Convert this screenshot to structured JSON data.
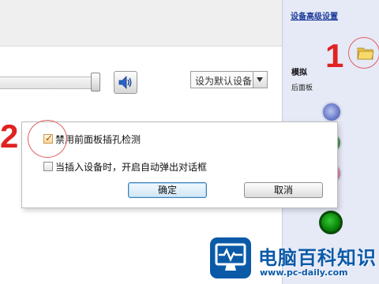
{
  "volume": {
    "level": 0.95
  },
  "default_device": {
    "label": "设为默认设备"
  },
  "right_panel": {
    "advanced_link": "设备高级设置",
    "section_title": "模拟",
    "section_subtitle": "后面板",
    "jacks": [
      "blue",
      "green",
      "pink",
      "green-active"
    ]
  },
  "annotations": {
    "one": "1",
    "two": "2",
    "color": "#e02222"
  },
  "popup": {
    "disable_front_panel": {
      "label": "禁用前面板插孔检测",
      "checked": true
    },
    "auto_popup": {
      "label": "当插入设备时，开启自动弹出对话框",
      "checked": false
    },
    "ok_label": "确定",
    "cancel_label": "取消"
  },
  "watermark": {
    "title": "电脑百科知识",
    "url": "www.pc-daily.com",
    "brand_color": "#0b5aa8"
  },
  "icons": {
    "speaker": "speaker-icon",
    "folder": "folder-icon",
    "monitor_logo": "monitor-icon"
  }
}
